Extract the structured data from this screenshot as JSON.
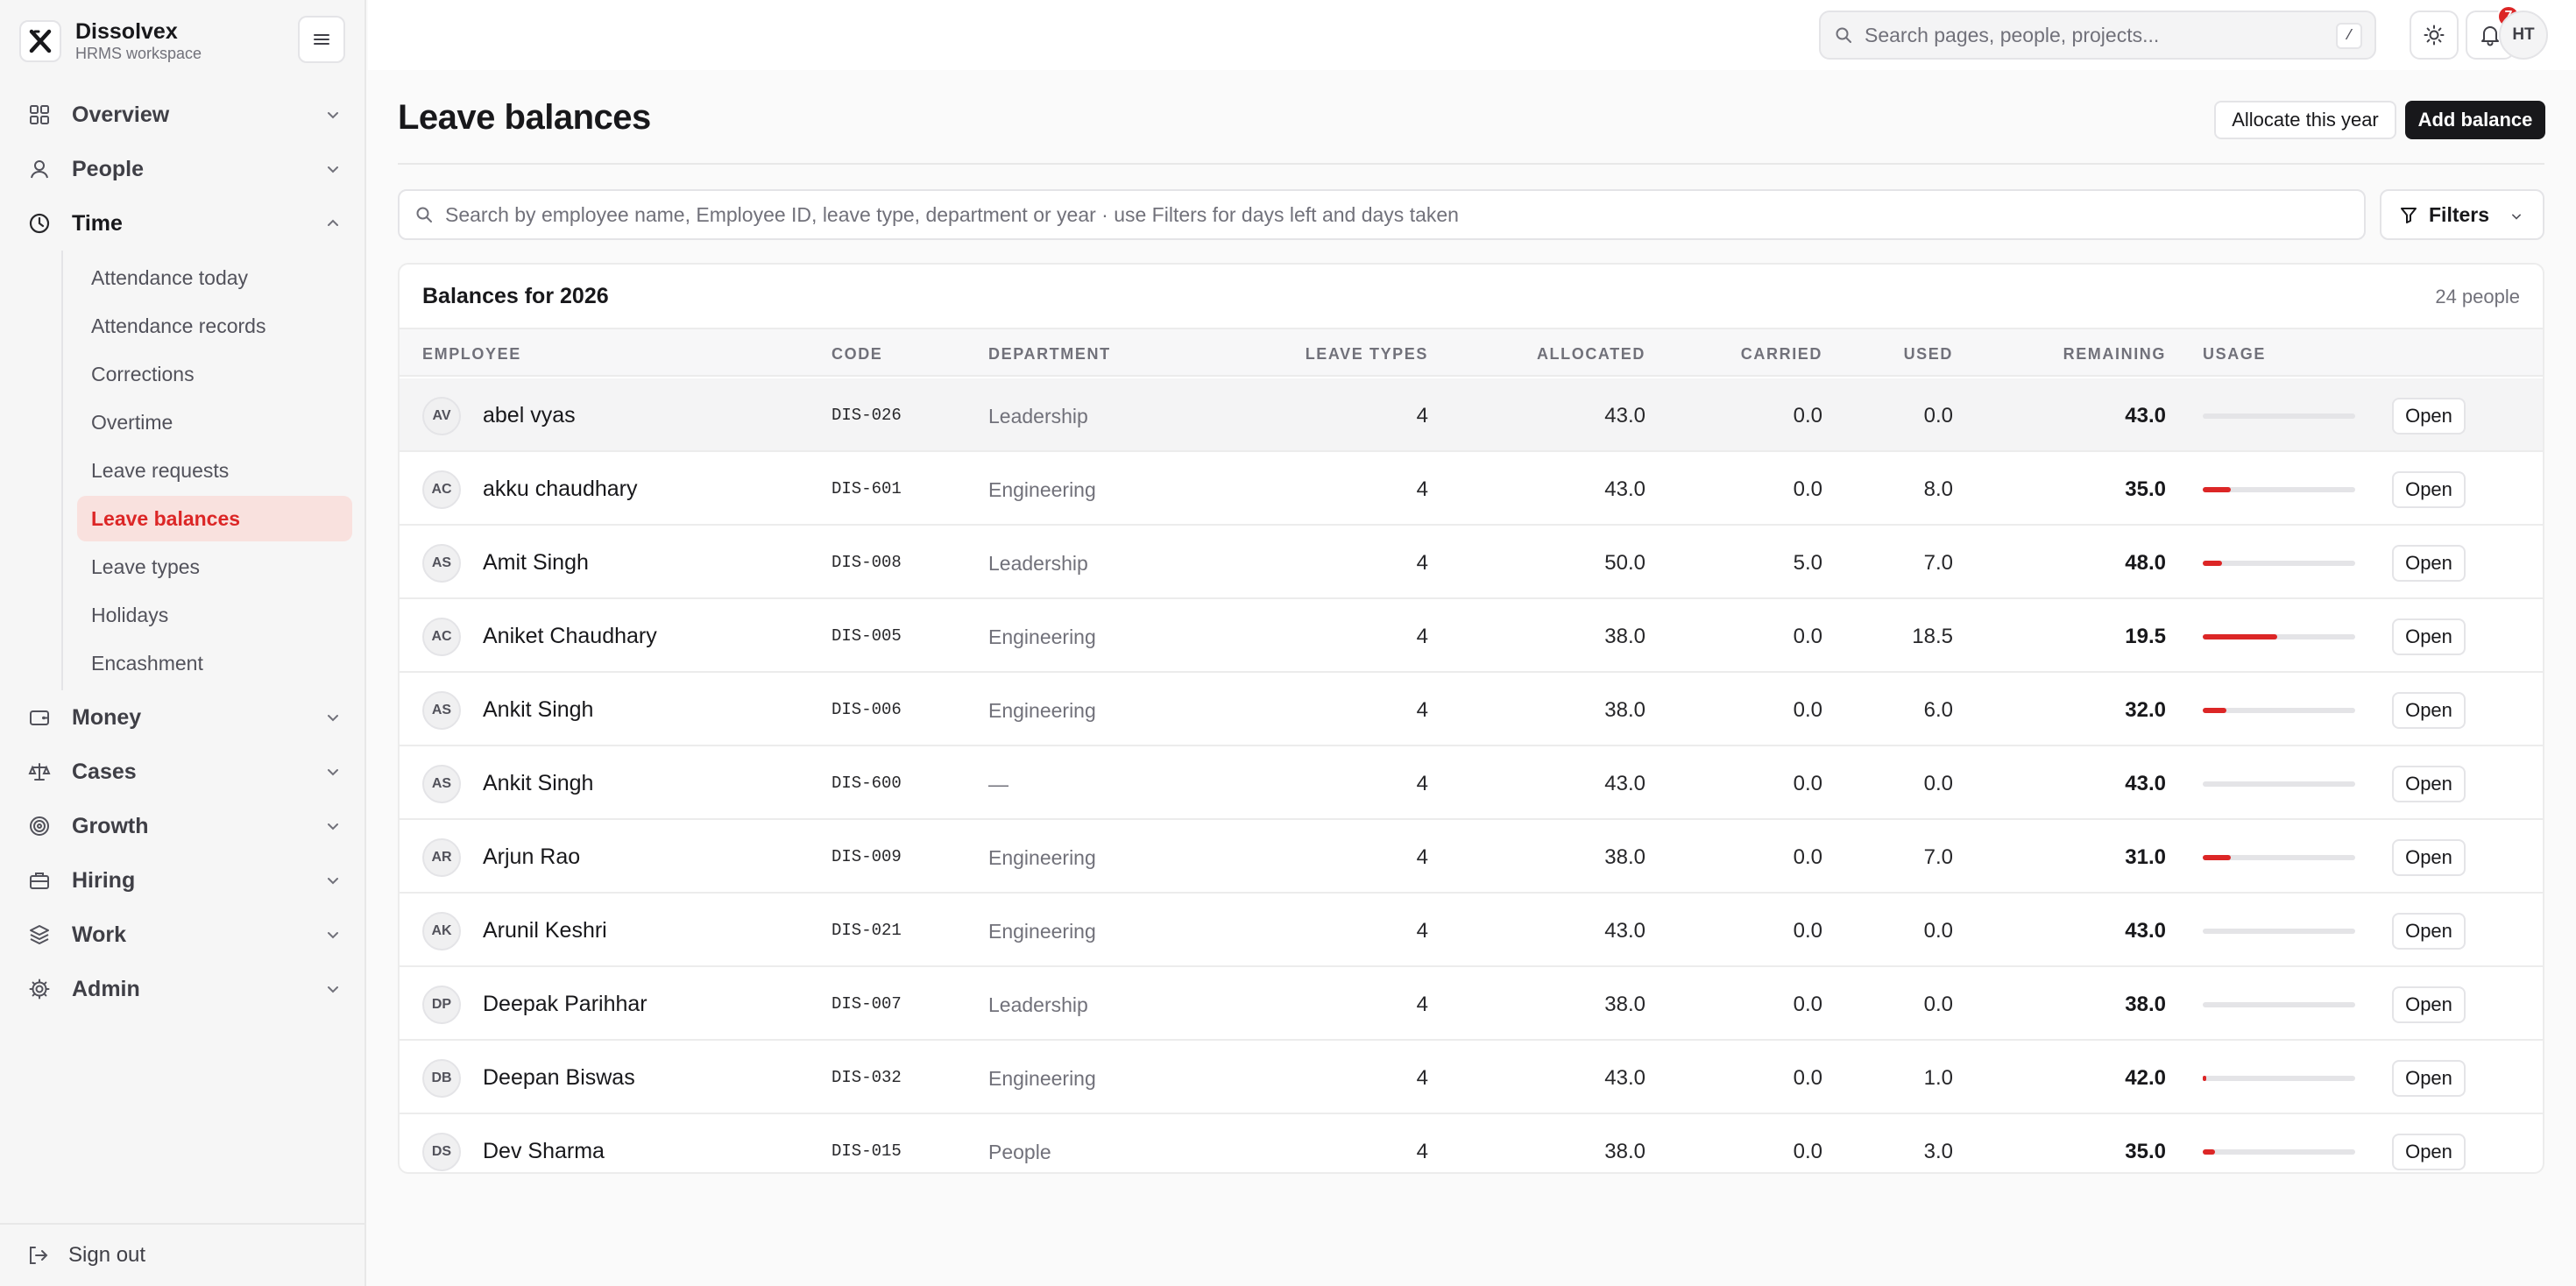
{
  "brand": {
    "name": "Dissolvex",
    "subtitle": "HRMS workspace"
  },
  "sidebar": {
    "groups": [
      {
        "label": "Overview",
        "icon": "grid-icon"
      },
      {
        "label": "People",
        "icon": "user-icon"
      },
      {
        "label": "Time",
        "icon": "clock-icon",
        "expanded": true,
        "items": [
          {
            "label": "Attendance today"
          },
          {
            "label": "Attendance records"
          },
          {
            "label": "Corrections"
          },
          {
            "label": "Overtime"
          },
          {
            "label": "Leave requests"
          },
          {
            "label": "Leave balances",
            "active": true
          },
          {
            "label": "Leave types"
          },
          {
            "label": "Holidays"
          },
          {
            "label": "Encashment"
          }
        ]
      },
      {
        "label": "Money",
        "icon": "wallet-icon"
      },
      {
        "label": "Cases",
        "icon": "scale-icon"
      },
      {
        "label": "Growth",
        "icon": "target-icon"
      },
      {
        "label": "Hiring",
        "icon": "briefcase-icon"
      },
      {
        "label": "Work",
        "icon": "layers-icon"
      },
      {
        "label": "Admin",
        "icon": "gear-icon"
      }
    ],
    "signout": "Sign out"
  },
  "topbar": {
    "search_placeholder": "Search pages, people, projects...",
    "shortcut": "/",
    "notifications_count": "7",
    "user_initials": "HT"
  },
  "page": {
    "title": "Leave balances",
    "allocate_label": "Allocate this year",
    "add_label": "Add balance",
    "search_placeholder": "Search by employee name, Employee ID, leave type, department or year · use Filters for days left and days taken",
    "filters_label": "Filters"
  },
  "table": {
    "title": "Balances for 2026",
    "count": "24 people",
    "columns": {
      "employee": "Employee",
      "code": "Code",
      "department": "Department",
      "leave_types": "Leave types",
      "allocated": "Allocated",
      "carried": "Carried",
      "used": "Used",
      "remaining": "Remaining",
      "usage": "Usage"
    },
    "open_label": "Open",
    "rows": [
      {
        "initials": "AV",
        "name": "abel vyas",
        "code": "DIS-026",
        "department": "Leadership",
        "leave_types": "4",
        "allocated": "43.0",
        "carried": "0.0",
        "used": "0.0",
        "remaining": "43.0",
        "usage": 0
      },
      {
        "initials": "AC",
        "name": "akku chaudhary",
        "code": "DIS-601",
        "department": "Engineering",
        "leave_types": "4",
        "allocated": "43.0",
        "carried": "0.0",
        "used": "8.0",
        "remaining": "35.0",
        "usage": 0.186
      },
      {
        "initials": "AS",
        "name": "Amit Singh",
        "code": "DIS-008",
        "department": "Leadership",
        "leave_types": "4",
        "allocated": "50.0",
        "carried": "5.0",
        "used": "7.0",
        "remaining": "48.0",
        "usage": 0.127
      },
      {
        "initials": "AC",
        "name": "Aniket Chaudhary",
        "code": "DIS-005",
        "department": "Engineering",
        "leave_types": "4",
        "allocated": "38.0",
        "carried": "0.0",
        "used": "18.5",
        "remaining": "19.5",
        "usage": 0.487
      },
      {
        "initials": "AS",
        "name": "Ankit Singh",
        "code": "DIS-006",
        "department": "Engineering",
        "leave_types": "4",
        "allocated": "38.0",
        "carried": "0.0",
        "used": "6.0",
        "remaining": "32.0",
        "usage": 0.158
      },
      {
        "initials": "AS",
        "name": "Ankit Singh",
        "code": "DIS-600",
        "department": "—",
        "leave_types": "4",
        "allocated": "43.0",
        "carried": "0.0",
        "used": "0.0",
        "remaining": "43.0",
        "usage": 0
      },
      {
        "initials": "AR",
        "name": "Arjun Rao",
        "code": "DIS-009",
        "department": "Engineering",
        "leave_types": "4",
        "allocated": "38.0",
        "carried": "0.0",
        "used": "7.0",
        "remaining": "31.0",
        "usage": 0.184
      },
      {
        "initials": "AK",
        "name": "Arunil Keshri",
        "code": "DIS-021",
        "department": "Engineering",
        "leave_types": "4",
        "allocated": "43.0",
        "carried": "0.0",
        "used": "0.0",
        "remaining": "43.0",
        "usage": 0
      },
      {
        "initials": "DP",
        "name": "Deepak Parihhar",
        "code": "DIS-007",
        "department": "Leadership",
        "leave_types": "4",
        "allocated": "38.0",
        "carried": "0.0",
        "used": "0.0",
        "remaining": "38.0",
        "usage": 0
      },
      {
        "initials": "DB",
        "name": "Deepan Biswas",
        "code": "DIS-032",
        "department": "Engineering",
        "leave_types": "4",
        "allocated": "43.0",
        "carried": "0.0",
        "used": "1.0",
        "remaining": "42.0",
        "usage": 0.023
      },
      {
        "initials": "DS",
        "name": "Dev Sharma",
        "code": "DIS-015",
        "department": "People",
        "leave_types": "4",
        "allocated": "38.0",
        "carried": "0.0",
        "used": "3.0",
        "remaining": "35.0",
        "usage": 0.079
      }
    ]
  },
  "colors": {
    "accent": "#dc2626",
    "active_bg": "#f9e1de",
    "dark_button": "#18181b"
  }
}
